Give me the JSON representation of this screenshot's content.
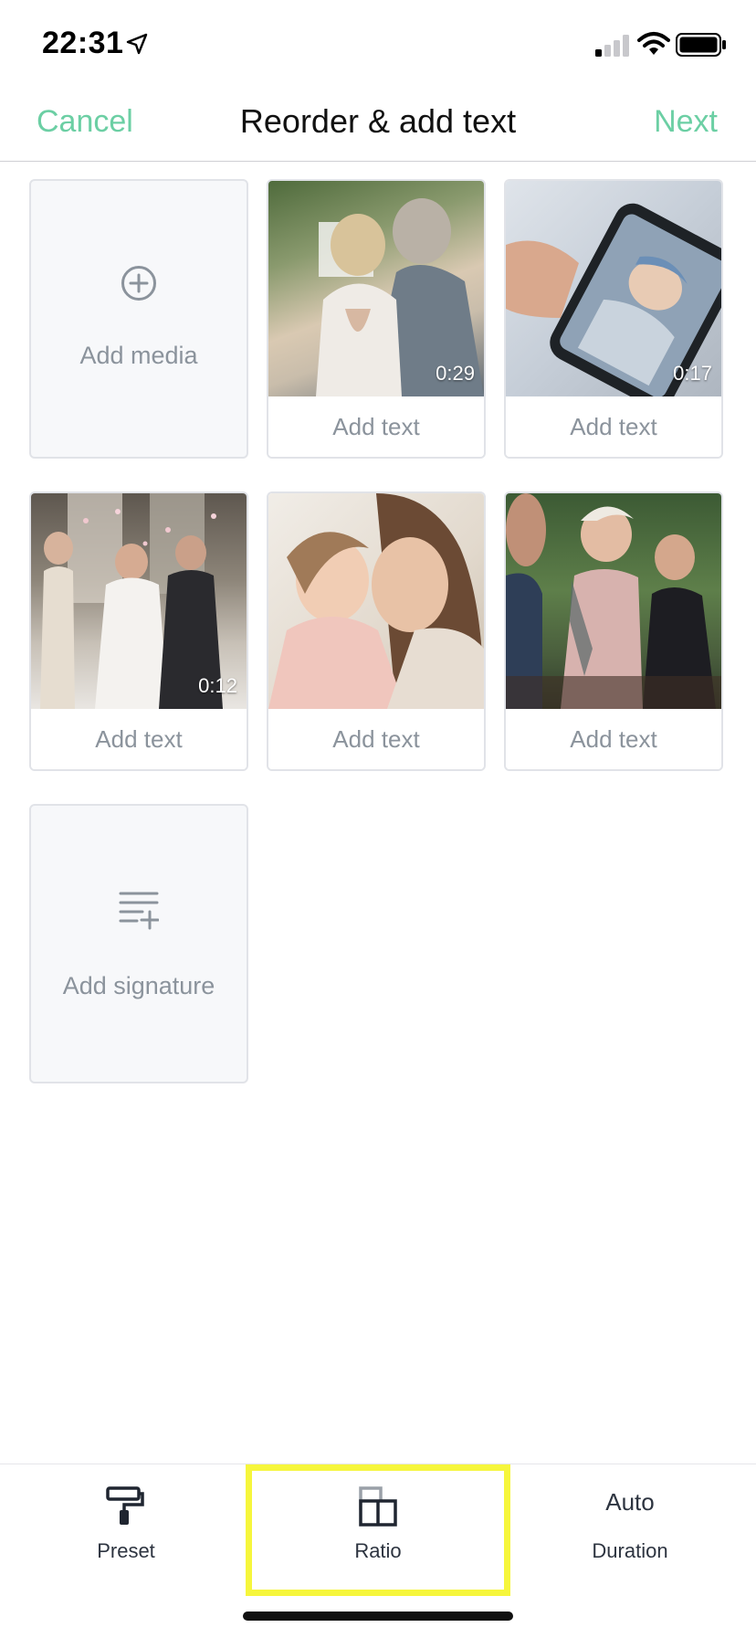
{
  "status_bar": {
    "time": "22:31"
  },
  "nav": {
    "cancel": "Cancel",
    "title": "Reorder & add text",
    "next": "Next"
  },
  "grid": {
    "add_media_label": "Add media",
    "add_signature_label": "Add signature",
    "items": [
      {
        "duration": "0:29",
        "caption": "Add text"
      },
      {
        "duration": "0:17",
        "caption": "Add text"
      },
      {
        "duration": "0:12",
        "caption": "Add text"
      },
      {
        "duration": "",
        "caption": "Add text"
      },
      {
        "duration": "",
        "caption": "Add text"
      }
    ]
  },
  "toolbar": {
    "preset_label": "Preset",
    "ratio_label": "Ratio",
    "duration_value": "Auto",
    "duration_label": "Duration"
  },
  "colors": {
    "accent": "#6ccfa4",
    "highlight": "#f6f63c",
    "muted_text": "#8b939c"
  }
}
